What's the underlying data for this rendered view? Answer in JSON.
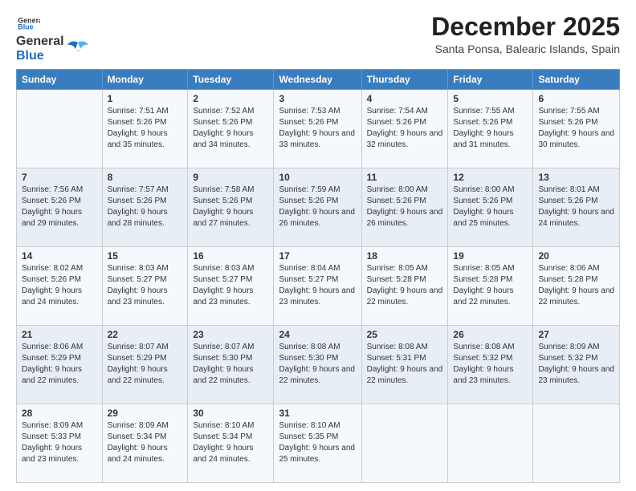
{
  "header": {
    "logo_general": "General",
    "logo_blue": "Blue",
    "month_title": "December 2025",
    "location": "Santa Ponsa, Balearic Islands, Spain"
  },
  "days_of_week": [
    "Sunday",
    "Monday",
    "Tuesday",
    "Wednesday",
    "Thursday",
    "Friday",
    "Saturday"
  ],
  "weeks": [
    [
      {
        "day": "",
        "sunrise": "",
        "sunset": "",
        "daylight": ""
      },
      {
        "day": "1",
        "sunrise": "Sunrise: 7:51 AM",
        "sunset": "Sunset: 5:26 PM",
        "daylight": "Daylight: 9 hours and 35 minutes."
      },
      {
        "day": "2",
        "sunrise": "Sunrise: 7:52 AM",
        "sunset": "Sunset: 5:26 PM",
        "daylight": "Daylight: 9 hours and 34 minutes."
      },
      {
        "day": "3",
        "sunrise": "Sunrise: 7:53 AM",
        "sunset": "Sunset: 5:26 PM",
        "daylight": "Daylight: 9 hours and 33 minutes."
      },
      {
        "day": "4",
        "sunrise": "Sunrise: 7:54 AM",
        "sunset": "Sunset: 5:26 PM",
        "daylight": "Daylight: 9 hours and 32 minutes."
      },
      {
        "day": "5",
        "sunrise": "Sunrise: 7:55 AM",
        "sunset": "Sunset: 5:26 PM",
        "daylight": "Daylight: 9 hours and 31 minutes."
      },
      {
        "day": "6",
        "sunrise": "Sunrise: 7:55 AM",
        "sunset": "Sunset: 5:26 PM",
        "daylight": "Daylight: 9 hours and 30 minutes."
      }
    ],
    [
      {
        "day": "7",
        "sunrise": "Sunrise: 7:56 AM",
        "sunset": "Sunset: 5:26 PM",
        "daylight": "Daylight: 9 hours and 29 minutes."
      },
      {
        "day": "8",
        "sunrise": "Sunrise: 7:57 AM",
        "sunset": "Sunset: 5:26 PM",
        "daylight": "Daylight: 9 hours and 28 minutes."
      },
      {
        "day": "9",
        "sunrise": "Sunrise: 7:58 AM",
        "sunset": "Sunset: 5:26 PM",
        "daylight": "Daylight: 9 hours and 27 minutes."
      },
      {
        "day": "10",
        "sunrise": "Sunrise: 7:59 AM",
        "sunset": "Sunset: 5:26 PM",
        "daylight": "Daylight: 9 hours and 26 minutes."
      },
      {
        "day": "11",
        "sunrise": "Sunrise: 8:00 AM",
        "sunset": "Sunset: 5:26 PM",
        "daylight": "Daylight: 9 hours and 26 minutes."
      },
      {
        "day": "12",
        "sunrise": "Sunrise: 8:00 AM",
        "sunset": "Sunset: 5:26 PM",
        "daylight": "Daylight: 9 hours and 25 minutes."
      },
      {
        "day": "13",
        "sunrise": "Sunrise: 8:01 AM",
        "sunset": "Sunset: 5:26 PM",
        "daylight": "Daylight: 9 hours and 24 minutes."
      }
    ],
    [
      {
        "day": "14",
        "sunrise": "Sunrise: 8:02 AM",
        "sunset": "Sunset: 5:26 PM",
        "daylight": "Daylight: 9 hours and 24 minutes."
      },
      {
        "day": "15",
        "sunrise": "Sunrise: 8:03 AM",
        "sunset": "Sunset: 5:27 PM",
        "daylight": "Daylight: 9 hours and 23 minutes."
      },
      {
        "day": "16",
        "sunrise": "Sunrise: 8:03 AM",
        "sunset": "Sunset: 5:27 PM",
        "daylight": "Daylight: 9 hours and 23 minutes."
      },
      {
        "day": "17",
        "sunrise": "Sunrise: 8:04 AM",
        "sunset": "Sunset: 5:27 PM",
        "daylight": "Daylight: 9 hours and 23 minutes."
      },
      {
        "day": "18",
        "sunrise": "Sunrise: 8:05 AM",
        "sunset": "Sunset: 5:28 PM",
        "daylight": "Daylight: 9 hours and 22 minutes."
      },
      {
        "day": "19",
        "sunrise": "Sunrise: 8:05 AM",
        "sunset": "Sunset: 5:28 PM",
        "daylight": "Daylight: 9 hours and 22 minutes."
      },
      {
        "day": "20",
        "sunrise": "Sunrise: 8:06 AM",
        "sunset": "Sunset: 5:28 PM",
        "daylight": "Daylight: 9 hours and 22 minutes."
      }
    ],
    [
      {
        "day": "21",
        "sunrise": "Sunrise: 8:06 AM",
        "sunset": "Sunset: 5:29 PM",
        "daylight": "Daylight: 9 hours and 22 minutes."
      },
      {
        "day": "22",
        "sunrise": "Sunrise: 8:07 AM",
        "sunset": "Sunset: 5:29 PM",
        "daylight": "Daylight: 9 hours and 22 minutes."
      },
      {
        "day": "23",
        "sunrise": "Sunrise: 8:07 AM",
        "sunset": "Sunset: 5:30 PM",
        "daylight": "Daylight: 9 hours and 22 minutes."
      },
      {
        "day": "24",
        "sunrise": "Sunrise: 8:08 AM",
        "sunset": "Sunset: 5:30 PM",
        "daylight": "Daylight: 9 hours and 22 minutes."
      },
      {
        "day": "25",
        "sunrise": "Sunrise: 8:08 AM",
        "sunset": "Sunset: 5:31 PM",
        "daylight": "Daylight: 9 hours and 22 minutes."
      },
      {
        "day": "26",
        "sunrise": "Sunrise: 8:08 AM",
        "sunset": "Sunset: 5:32 PM",
        "daylight": "Daylight: 9 hours and 23 minutes."
      },
      {
        "day": "27",
        "sunrise": "Sunrise: 8:09 AM",
        "sunset": "Sunset: 5:32 PM",
        "daylight": "Daylight: 9 hours and 23 minutes."
      }
    ],
    [
      {
        "day": "28",
        "sunrise": "Sunrise: 8:09 AM",
        "sunset": "Sunset: 5:33 PM",
        "daylight": "Daylight: 9 hours and 23 minutes."
      },
      {
        "day": "29",
        "sunrise": "Sunrise: 8:09 AM",
        "sunset": "Sunset: 5:34 PM",
        "daylight": "Daylight: 9 hours and 24 minutes."
      },
      {
        "day": "30",
        "sunrise": "Sunrise: 8:10 AM",
        "sunset": "Sunset: 5:34 PM",
        "daylight": "Daylight: 9 hours and 24 minutes."
      },
      {
        "day": "31",
        "sunrise": "Sunrise: 8:10 AM",
        "sunset": "Sunset: 5:35 PM",
        "daylight": "Daylight: 9 hours and 25 minutes."
      },
      {
        "day": "",
        "sunrise": "",
        "sunset": "",
        "daylight": ""
      },
      {
        "day": "",
        "sunrise": "",
        "sunset": "",
        "daylight": ""
      },
      {
        "day": "",
        "sunrise": "",
        "sunset": "",
        "daylight": ""
      }
    ]
  ]
}
